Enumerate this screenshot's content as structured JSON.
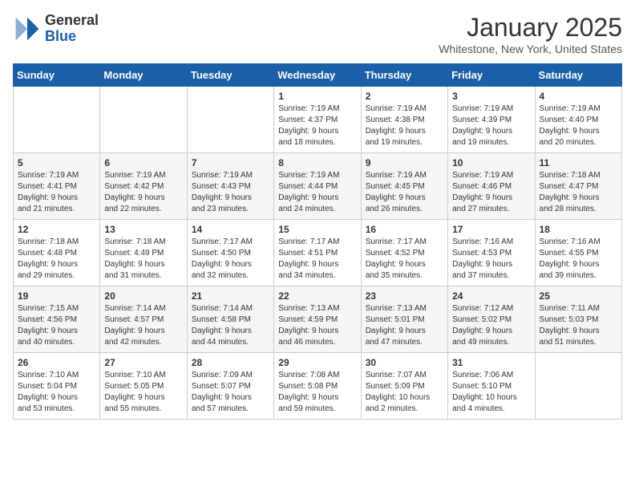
{
  "header": {
    "logo_line1": "General",
    "logo_line2": "Blue",
    "month": "January 2025",
    "location": "Whitestone, New York, United States"
  },
  "days_of_week": [
    "Sunday",
    "Monday",
    "Tuesday",
    "Wednesday",
    "Thursday",
    "Friday",
    "Saturday"
  ],
  "weeks": [
    [
      {
        "day": "",
        "info": ""
      },
      {
        "day": "",
        "info": ""
      },
      {
        "day": "",
        "info": ""
      },
      {
        "day": "1",
        "info": "Sunrise: 7:19 AM\nSunset: 4:37 PM\nDaylight: 9 hours\nand 18 minutes."
      },
      {
        "day": "2",
        "info": "Sunrise: 7:19 AM\nSunset: 4:38 PM\nDaylight: 9 hours\nand 19 minutes."
      },
      {
        "day": "3",
        "info": "Sunrise: 7:19 AM\nSunset: 4:39 PM\nDaylight: 9 hours\nand 19 minutes."
      },
      {
        "day": "4",
        "info": "Sunrise: 7:19 AM\nSunset: 4:40 PM\nDaylight: 9 hours\nand 20 minutes."
      }
    ],
    [
      {
        "day": "5",
        "info": "Sunrise: 7:19 AM\nSunset: 4:41 PM\nDaylight: 9 hours\nand 21 minutes."
      },
      {
        "day": "6",
        "info": "Sunrise: 7:19 AM\nSunset: 4:42 PM\nDaylight: 9 hours\nand 22 minutes."
      },
      {
        "day": "7",
        "info": "Sunrise: 7:19 AM\nSunset: 4:43 PM\nDaylight: 9 hours\nand 23 minutes."
      },
      {
        "day": "8",
        "info": "Sunrise: 7:19 AM\nSunset: 4:44 PM\nDaylight: 9 hours\nand 24 minutes."
      },
      {
        "day": "9",
        "info": "Sunrise: 7:19 AM\nSunset: 4:45 PM\nDaylight: 9 hours\nand 26 minutes."
      },
      {
        "day": "10",
        "info": "Sunrise: 7:19 AM\nSunset: 4:46 PM\nDaylight: 9 hours\nand 27 minutes."
      },
      {
        "day": "11",
        "info": "Sunrise: 7:18 AM\nSunset: 4:47 PM\nDaylight: 9 hours\nand 28 minutes."
      }
    ],
    [
      {
        "day": "12",
        "info": "Sunrise: 7:18 AM\nSunset: 4:48 PM\nDaylight: 9 hours\nand 29 minutes."
      },
      {
        "day": "13",
        "info": "Sunrise: 7:18 AM\nSunset: 4:49 PM\nDaylight: 9 hours\nand 31 minutes."
      },
      {
        "day": "14",
        "info": "Sunrise: 7:17 AM\nSunset: 4:50 PM\nDaylight: 9 hours\nand 32 minutes."
      },
      {
        "day": "15",
        "info": "Sunrise: 7:17 AM\nSunset: 4:51 PM\nDaylight: 9 hours\nand 34 minutes."
      },
      {
        "day": "16",
        "info": "Sunrise: 7:17 AM\nSunset: 4:52 PM\nDaylight: 9 hours\nand 35 minutes."
      },
      {
        "day": "17",
        "info": "Sunrise: 7:16 AM\nSunset: 4:53 PM\nDaylight: 9 hours\nand 37 minutes."
      },
      {
        "day": "18",
        "info": "Sunrise: 7:16 AM\nSunset: 4:55 PM\nDaylight: 9 hours\nand 39 minutes."
      }
    ],
    [
      {
        "day": "19",
        "info": "Sunrise: 7:15 AM\nSunset: 4:56 PM\nDaylight: 9 hours\nand 40 minutes."
      },
      {
        "day": "20",
        "info": "Sunrise: 7:14 AM\nSunset: 4:57 PM\nDaylight: 9 hours\nand 42 minutes."
      },
      {
        "day": "21",
        "info": "Sunrise: 7:14 AM\nSunset: 4:58 PM\nDaylight: 9 hours\nand 44 minutes."
      },
      {
        "day": "22",
        "info": "Sunrise: 7:13 AM\nSunset: 4:59 PM\nDaylight: 9 hours\nand 46 minutes."
      },
      {
        "day": "23",
        "info": "Sunrise: 7:13 AM\nSunset: 5:01 PM\nDaylight: 9 hours\nand 47 minutes."
      },
      {
        "day": "24",
        "info": "Sunrise: 7:12 AM\nSunset: 5:02 PM\nDaylight: 9 hours\nand 49 minutes."
      },
      {
        "day": "25",
        "info": "Sunrise: 7:11 AM\nSunset: 5:03 PM\nDaylight: 9 hours\nand 51 minutes."
      }
    ],
    [
      {
        "day": "26",
        "info": "Sunrise: 7:10 AM\nSunset: 5:04 PM\nDaylight: 9 hours\nand 53 minutes."
      },
      {
        "day": "27",
        "info": "Sunrise: 7:10 AM\nSunset: 5:05 PM\nDaylight: 9 hours\nand 55 minutes."
      },
      {
        "day": "28",
        "info": "Sunrise: 7:09 AM\nSunset: 5:07 PM\nDaylight: 9 hours\nand 57 minutes."
      },
      {
        "day": "29",
        "info": "Sunrise: 7:08 AM\nSunset: 5:08 PM\nDaylight: 9 hours\nand 59 minutes."
      },
      {
        "day": "30",
        "info": "Sunrise: 7:07 AM\nSunset: 5:09 PM\nDaylight: 10 hours\nand 2 minutes."
      },
      {
        "day": "31",
        "info": "Sunrise: 7:06 AM\nSunset: 5:10 PM\nDaylight: 10 hours\nand 4 minutes."
      },
      {
        "day": "",
        "info": ""
      }
    ]
  ]
}
